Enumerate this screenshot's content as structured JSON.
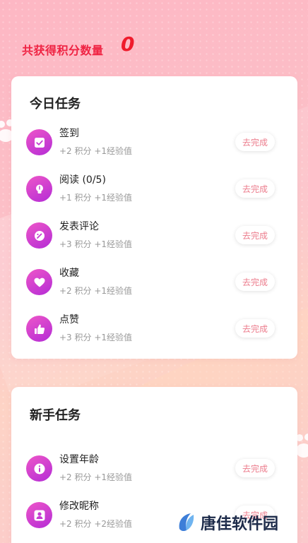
{
  "header": {
    "title": "共获得积分数量",
    "value": "0"
  },
  "today": {
    "title": "今日任务",
    "tasks": [
      {
        "name": "签到",
        "reward": "+2 积分 +1经验值",
        "button": "去完成",
        "icon": "checkbox-icon"
      },
      {
        "name": "阅读 (0/5)",
        "reward": "+1 积分 +1经验值",
        "button": "去完成",
        "icon": "lightbulb-icon"
      },
      {
        "name": "发表评论",
        "reward": "+3 积分 +1经验值",
        "button": "去完成",
        "icon": "comment-edit-icon"
      },
      {
        "name": "收藏",
        "reward": "+2 积分 +1经验值",
        "button": "去完成",
        "icon": "heart-icon"
      },
      {
        "name": "点赞",
        "reward": "+3 积分 +1经验值",
        "button": "去完成",
        "icon": "thumbs-up-icon"
      }
    ]
  },
  "newbie": {
    "title": "新手任务",
    "tasks": [
      {
        "name": "设置年龄",
        "reward": "+2 积分 +1经验值",
        "button": "去完成",
        "icon": "info-icon"
      },
      {
        "name": "修改昵称",
        "reward": "+2 积分 +2经验值",
        "button": "去完成",
        "icon": "user-icon"
      }
    ]
  },
  "watermark": {
    "text": "唐佳软件园"
  },
  "colors": {
    "accent": "#ef2343",
    "icon_gradient_start": "#ee56c8",
    "icon_gradient_end": "#b42cd6",
    "button_text": "#ec7c8c"
  }
}
